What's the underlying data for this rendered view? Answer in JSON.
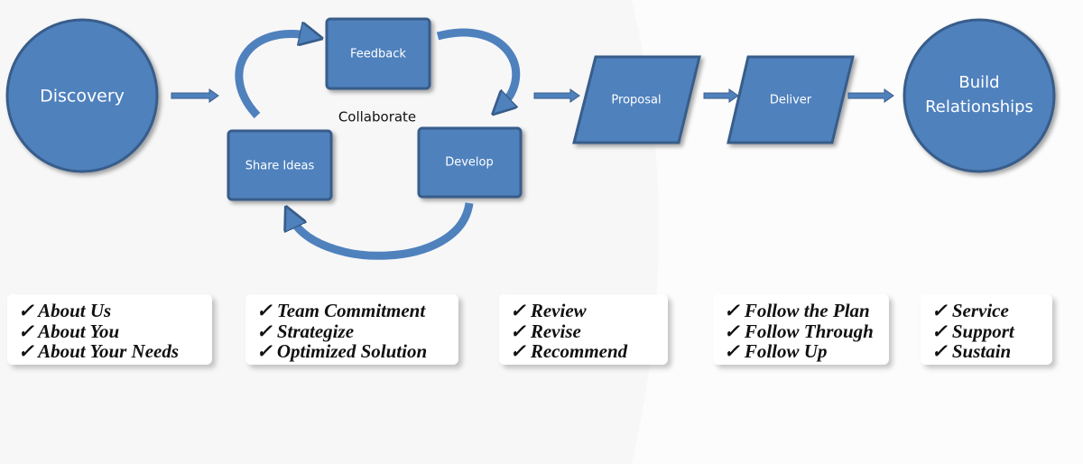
{
  "colors": {
    "shape_fill": "#4f81bd",
    "shape_stroke": "#385d8a",
    "text": "#ffffff"
  },
  "nodes": {
    "discovery": "Discovery",
    "feedback": "Feedback",
    "share_ideas": "Share Ideas",
    "develop": "Develop",
    "collaborate": "Collaborate",
    "proposal": "Proposal",
    "deliver": "Deliver",
    "build_relationships": [
      "Build",
      "Relationships"
    ]
  },
  "check_glyph": "✓",
  "cards": [
    {
      "items": [
        "✓ About Us",
        "✓ About You",
        "✓ About Your Needs"
      ]
    },
    {
      "items": [
        "✓ Team Commitment",
        "✓ Strategize",
        "✓ Optimized Solution"
      ]
    },
    {
      "items": [
        "✓ Review",
        "✓ Revise",
        "✓ Recommend"
      ]
    },
    {
      "items": [
        "✓ Follow the Plan",
        "✓ Follow Through",
        "✓ Follow Up"
      ]
    },
    {
      "items": [
        "✓ Service",
        "✓ Support",
        "✓ Sustain"
      ]
    }
  ]
}
